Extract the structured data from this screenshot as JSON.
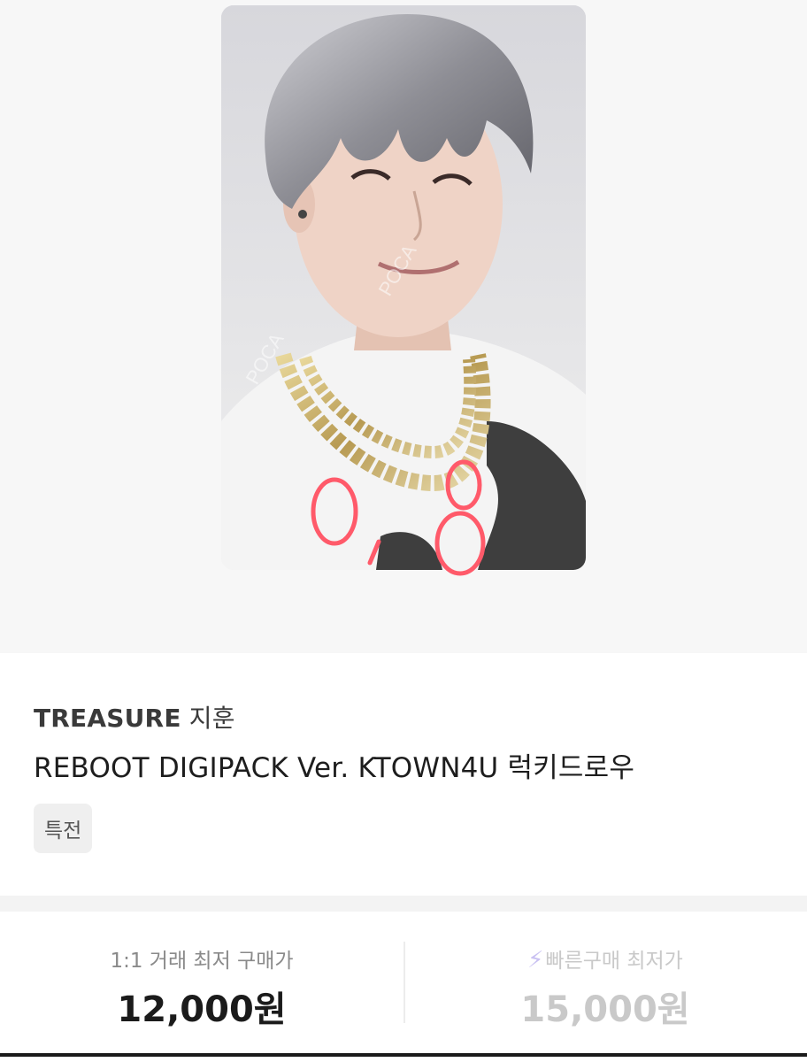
{
  "product": {
    "group": "TREASURE",
    "member": "지훈",
    "title": "REBOOT DIGIPACK Ver. KTOWN4U 럭키드로우",
    "tag": "특전",
    "handwritten_note": "0,8",
    "watermark": "POCA"
  },
  "prices": {
    "one_to_one": {
      "label": "1:1 거래 최저 구매가",
      "amount": "12,000원"
    },
    "fast": {
      "icon": "lightning-icon",
      "label": "빠른구매 최저가",
      "amount": "15,000원"
    }
  },
  "colors": {
    "accent_lightning": "#c9c1f2",
    "annotation_red": "#ff5a6a"
  }
}
